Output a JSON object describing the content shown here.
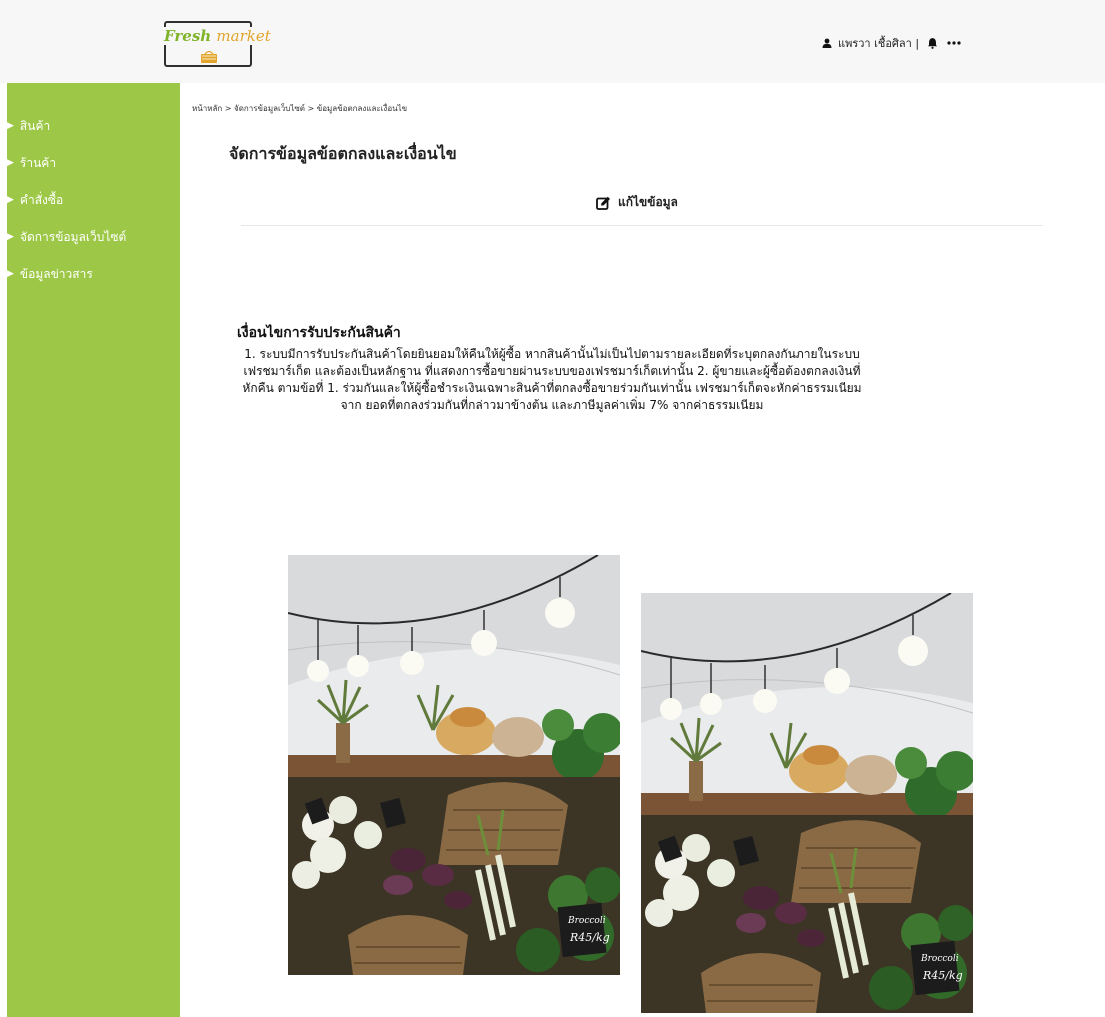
{
  "header": {
    "logo_text_a": "Fresh",
    "logo_text_b": "market",
    "user_name": "แพรวา เชื้อศิลา |",
    "user_icon": "user-icon",
    "bell_icon": "bell-icon",
    "more_icon": "more-icon"
  },
  "sidebar": {
    "items": [
      {
        "label": "สินค้า"
      },
      {
        "label": "ร้านค้า"
      },
      {
        "label": "คำสั่งซื้อ"
      },
      {
        "label": "จัดการข้อมูลเว็บไซต์"
      },
      {
        "label": "ข้อมูลข่าวสาร"
      }
    ]
  },
  "breadcrumb": "หน้าหลัก > จัดการข้อมูลเว็บไซต์ > ข้อมูลข้อตกลงและเงื่อนไข",
  "page_title": "จัดการข้อมูลข้อตกลงและเงื่อนไข",
  "edit_label": "แก้ไขข้อมูล",
  "section_title": "เงื่อนไขการรับประกันสินค้า",
  "terms_text": "1. ระบบมีการรับประกันสินค้าโดยยินยอมให้คืนให้ผู้ซื้อ หากสินค้านั้นไม่เป็นไปตามรายละเอียดที่ระบุตกลงกันภายในระบบ เฟรชมาร์เก็ต และต้องเป็นหลักฐาน ที่แสดงการซื้อขายผ่านระบบของเฟรชมาร์เก็ตเท่านั้น 2. ผู้ขายและผู้ซื้อต้องตกลงเงินที่หักคืน ตามข้อที่ 1. ร่วมกันและให้ผู้ซื้อชำระเงินเฉพาะสินค้าที่ตกลงซื้อขายร่วมกันเท่านั้น เฟรชมาร์เก็ตจะหักค่าธรรมเนียมจาก ยอดที่ตกลงร่วมกันที่กล่าวมาข้างต้น และภาษีมูลค่าเพิ่ม 7% จากค่าธรรมเนียม",
  "photos": [
    {
      "sign_line1": "Broccoli",
      "sign_line2": "R45/kg"
    },
    {
      "sign_line1": "Broccoli",
      "sign_line2": "R45/kg"
    }
  ],
  "colors": {
    "sidebar": "#9dc847",
    "header": "#f7f7f7",
    "logo_green": "#7fb428",
    "logo_gold": "#e2a52a"
  }
}
